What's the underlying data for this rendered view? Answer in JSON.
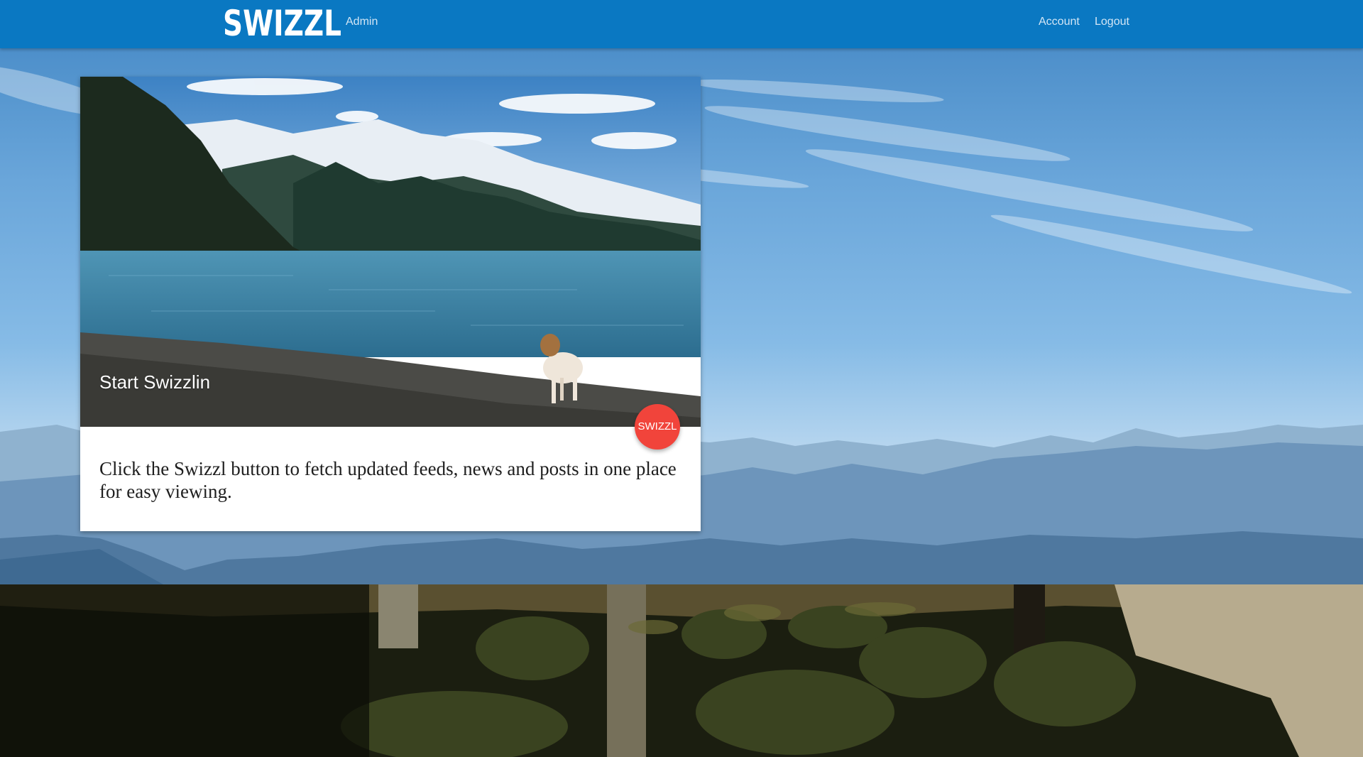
{
  "nav": {
    "brand": "SWIZZL",
    "admin_label": "Admin",
    "account_label": "Account",
    "logout_label": "Logout"
  },
  "card": {
    "title": "Start Swizzlin",
    "fab_label": "SWIZZL",
    "description": "Click the Swizzl button to fetch updated feeds, news and posts in one place for easy viewing."
  },
  "colors": {
    "navbar": "#0a78c2",
    "fab": "#f1443b"
  }
}
